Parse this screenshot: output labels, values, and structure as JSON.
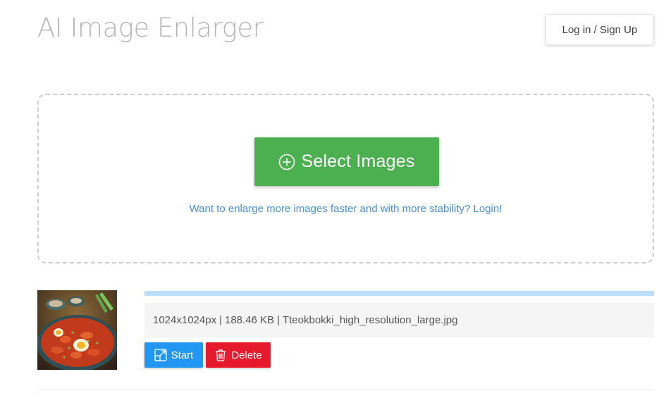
{
  "header": {
    "title": "AI Image Enlarger",
    "login_label": "Log in / Sign Up"
  },
  "dropzone": {
    "select_label": "Select Images",
    "login_prompt": "Want to enlarge more images faster and with more stability? Login!",
    "icon": "plus-circle-icon"
  },
  "file": {
    "dimensions": "1024x1024px",
    "size": "188.46 KB",
    "filename": "Tteokbokki_high_resolution_large.jpg",
    "separator": "|",
    "progress": 1.0,
    "start_label": "Start",
    "delete_label": "Delete",
    "start_icon": "enlarge-icon",
    "delete_icon": "trash-icon"
  },
  "colors": {
    "select_button": "#4caf50",
    "start_button": "#2196f3",
    "delete_button": "#e6192d",
    "link": "#4a90d9",
    "progress_fill": "#bbdefb"
  }
}
